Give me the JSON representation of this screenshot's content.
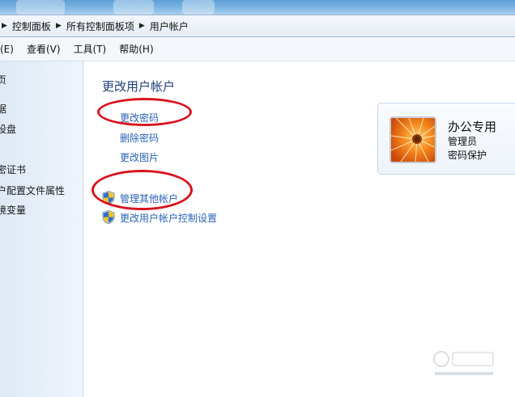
{
  "breadcrumb": {
    "items": [
      "控制面板",
      "所有控制面板项",
      "用户帐户"
    ]
  },
  "menubar": {
    "edit": "(E)",
    "view": "查看(V)",
    "tools": "工具(T)",
    "help": "帮助(H)"
  },
  "left_pane": {
    "items": [
      "页",
      "据",
      "设盘",
      "密证书",
      "户配置文件属性",
      "境变量"
    ]
  },
  "main": {
    "heading": "更改用户帐户",
    "links": {
      "change_password": "更改密码",
      "remove_password": "删除密码",
      "change_picture": "更改图片",
      "manage_other": "管理其他帐户",
      "uac_settings": "更改用户帐户控制设置"
    }
  },
  "account": {
    "name": "办公专用",
    "role": "管理员",
    "status": "密码保护"
  },
  "colors": {
    "link": "#2a63b8",
    "heading": "#1e3f79",
    "annotation": "#d8141e"
  },
  "icons": {
    "breadcrumb_separator": "arrow-right-icon",
    "uac": "uac-shield-icon",
    "avatar": "flower-icon"
  }
}
